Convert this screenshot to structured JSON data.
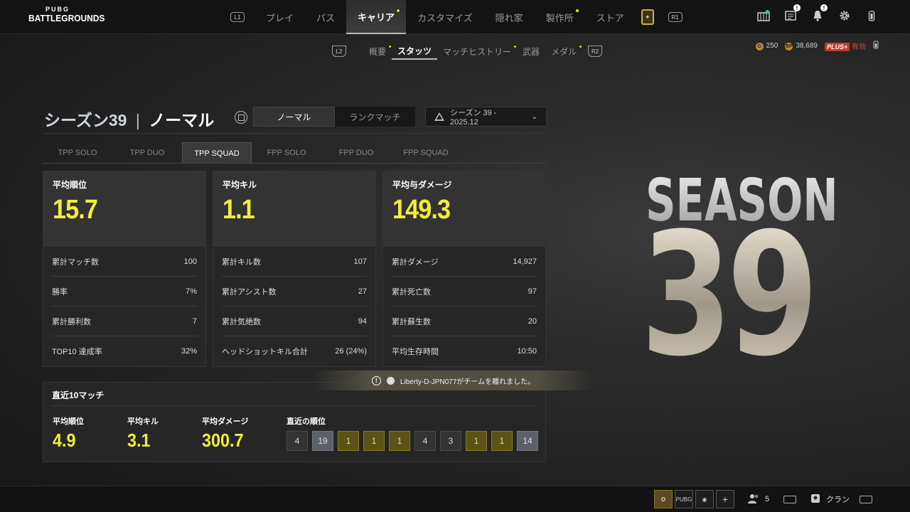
{
  "logo": {
    "line1": "PUBG",
    "line2": "BATTLEGROUNDS"
  },
  "nav": {
    "left_button": "L1",
    "right_button": "R1",
    "items": [
      {
        "label": "プレイ",
        "active": false,
        "dot": false
      },
      {
        "label": "パス",
        "active": false,
        "dot": false
      },
      {
        "label": "キャリア",
        "active": true,
        "dot": true
      },
      {
        "label": "カスタマイズ",
        "active": false,
        "dot": false
      },
      {
        "label": "隠れ家",
        "active": false,
        "dot": false
      },
      {
        "label": "製作所",
        "active": false,
        "dot": true
      },
      {
        "label": "ストア",
        "active": false,
        "dot": false
      }
    ]
  },
  "subnav": {
    "left_button": "L2",
    "right_button": "R2",
    "items": [
      {
        "label": "概要",
        "active": false,
        "dot": true
      },
      {
        "label": "スタッツ",
        "active": false,
        "dot": false
      },
      {
        "label": "マッチヒストリー",
        "active": false,
        "dot": true
      },
      {
        "label": "武器",
        "active": false,
        "dot": false
      },
      {
        "label": "メダル",
        "active": false,
        "dot": true
      }
    ],
    "active_index": 1
  },
  "currency": {
    "coin_glyph": "G",
    "bp_glyph": "BP",
    "gcoin": "250",
    "bp": "38,689",
    "plus_label": "PLUS+",
    "plus_status": "有効"
  },
  "stats": {
    "title_season": "シーズン39",
    "title_sep": "|",
    "title_mode": "ノーマル",
    "mode_toggle": [
      "ノーマル",
      "ランクマッチ"
    ],
    "season_select": "シーズン 39 - 2025.12",
    "perspective_tabs": [
      "TPP SOLO",
      "TPP DUO",
      "TPP SQUAD",
      "FPP SOLO",
      "FPP DUO",
      "FPP SQUAD"
    ],
    "active_tab": 2,
    "cards": [
      {
        "label": "平均順位",
        "value": "15.7",
        "rows": [
          {
            "k": "累計マッチ数",
            "v": "100"
          },
          {
            "k": "勝率",
            "v": "7%"
          },
          {
            "k": "累計勝利数",
            "v": "7"
          },
          {
            "k": "TOP10 達成率",
            "v": "32%"
          }
        ]
      },
      {
        "label": "平均キル",
        "value": "1.1",
        "rows": [
          {
            "k": "累計キル数",
            "v": "107"
          },
          {
            "k": "累計アシスト数",
            "v": "27"
          },
          {
            "k": "累計気絶数",
            "v": "94"
          },
          {
            "k": "ヘッドショットキル合計",
            "v": "26 (24%)"
          }
        ]
      },
      {
        "label": "平均与ダメージ",
        "value": "149.3",
        "rows": [
          {
            "k": "累計ダメージ",
            "v": "14,927"
          },
          {
            "k": "累計死亡数",
            "v": "97"
          },
          {
            "k": "累計蘇生数",
            "v": "20"
          },
          {
            "k": "平均生存時間",
            "v": "10:50"
          }
        ]
      }
    ]
  },
  "recent": {
    "title": "直近10マッチ",
    "avg_rank_label": "平均順位",
    "avg_rank": "4.9",
    "avg_kill_label": "平均キル",
    "avg_kill": "3.1",
    "avg_damage_label": "平均ダメージ",
    "avg_damage": "300.7",
    "ranks_label": "直近の順位",
    "ranks": [
      {
        "v": "4",
        "style": "dark"
      },
      {
        "v": "19",
        "style": "grey"
      },
      {
        "v": "1",
        "style": "gold"
      },
      {
        "v": "1",
        "style": "gold"
      },
      {
        "v": "1",
        "style": "gold"
      },
      {
        "v": "4",
        "style": "dark"
      },
      {
        "v": "3",
        "style": "dark"
      },
      {
        "v": "1",
        "style": "gold"
      },
      {
        "v": "1",
        "style": "gold"
      },
      {
        "v": "14",
        "style": "grey"
      }
    ]
  },
  "toast": {
    "message": "Liberty-D-JPN077がチームを離れました。"
  },
  "season_art": {
    "word": "SEASON",
    "number": "39"
  },
  "bottombar": {
    "tag_label": "PUBG",
    "plus_label": "+",
    "party_count": "5",
    "clan_label": "クラン"
  },
  "colors": {
    "accent_yellow": "#f1ee3a",
    "gold_rank": "#5a5216",
    "grey_rank": "#5c6068",
    "plus_red": "#c23a2a"
  }
}
